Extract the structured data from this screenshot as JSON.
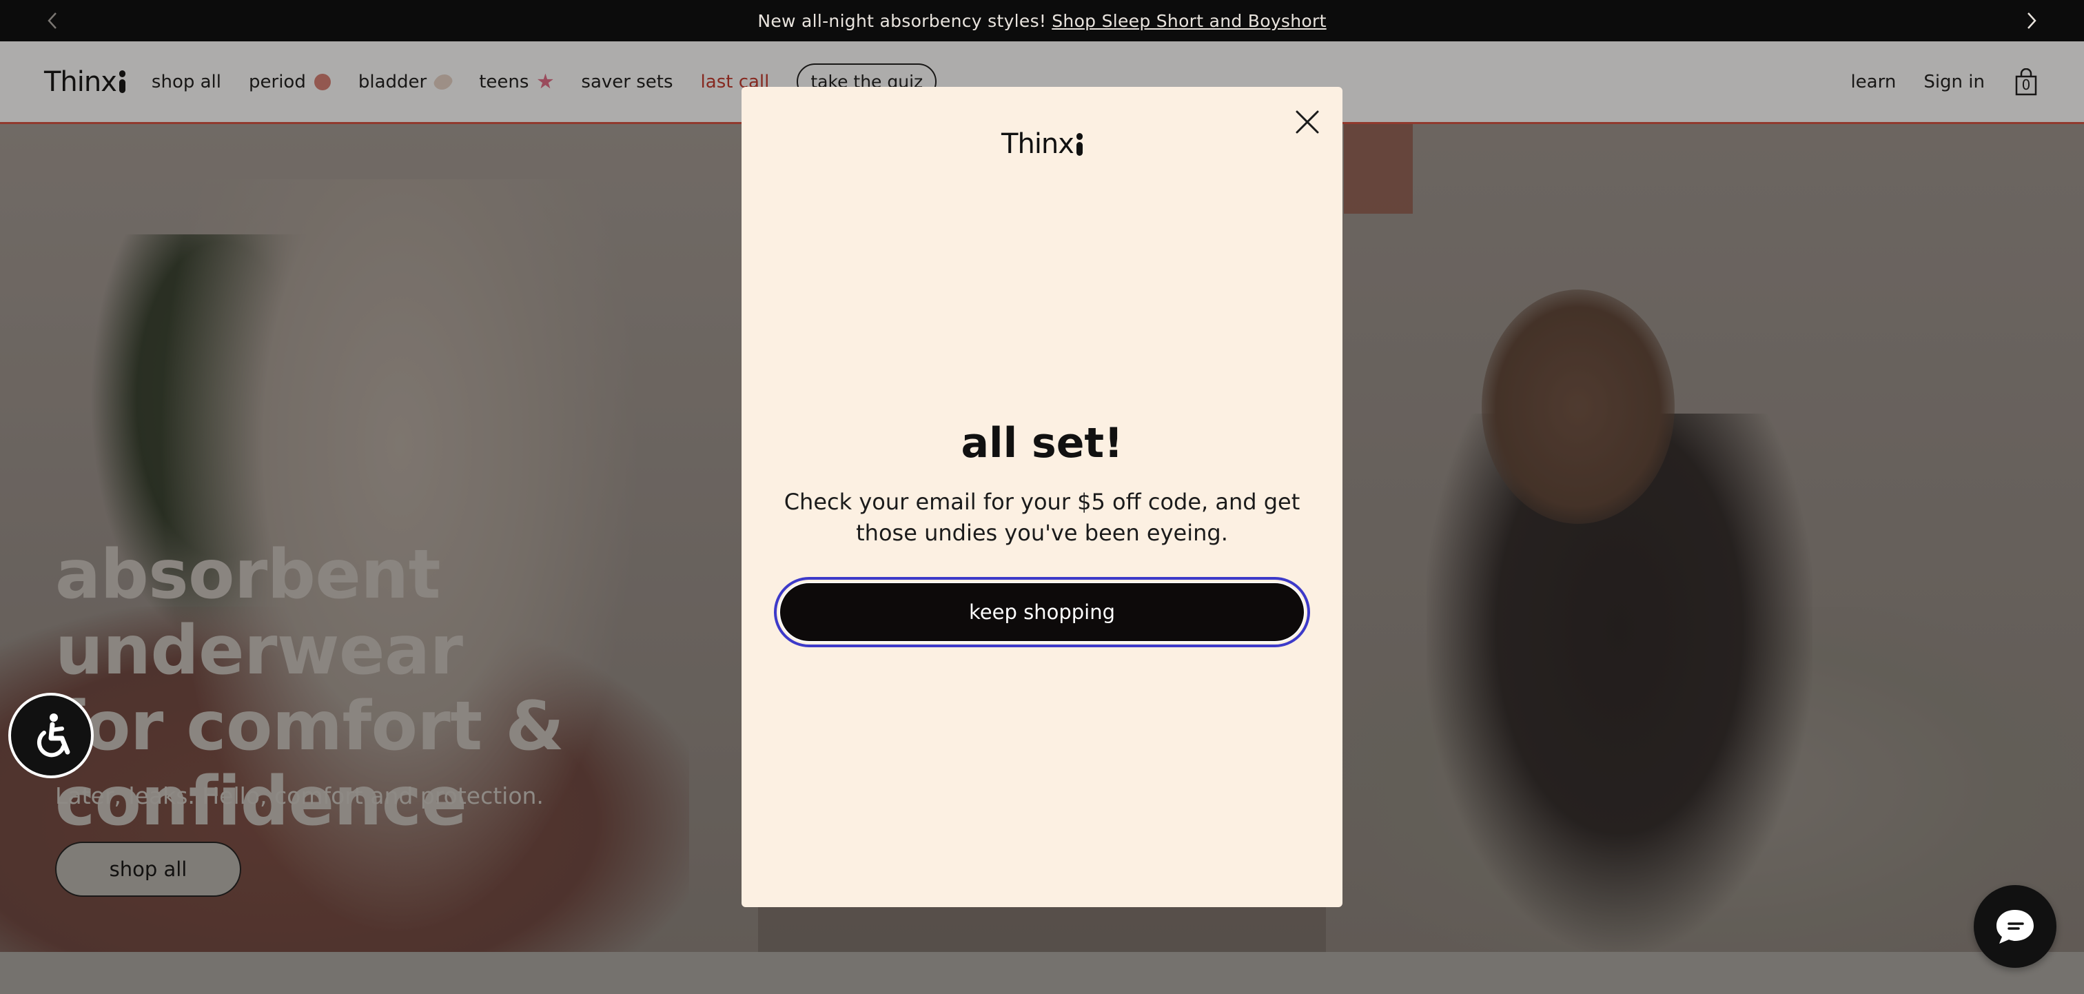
{
  "announcement": {
    "text": "New all-night absorbency styles!",
    "link": "Shop Sleep Short and Boyshort"
  },
  "brand": {
    "name": "Thinx"
  },
  "nav": {
    "items": [
      {
        "label": "shop all"
      },
      {
        "label": "period"
      },
      {
        "label": "bladder"
      },
      {
        "label": "teens"
      },
      {
        "label": "saver sets"
      },
      {
        "label": "last call"
      }
    ],
    "quiz": "take the quiz",
    "learn": "learn",
    "signin": "Sign in",
    "cart_count": "0"
  },
  "hero": {
    "title_line1": "absorbent underwear",
    "title_line2": "for comfort &",
    "title_line3": "confidence",
    "subtitle": "Later, leaks. Hello, comfort and protection.",
    "button": "shop all"
  },
  "modal": {
    "logo": "Thinx",
    "title": "all set!",
    "body": "Check your email for your $5 off code, and get those undies you've been eyeing.",
    "button": "keep shopping"
  },
  "colors": {
    "announce_bg": "#0c0c0c",
    "accent_red": "#c4362a",
    "modal_bg": "#fcf0e2",
    "focus_ring": "#3d3ac9"
  },
  "icons": {
    "announce_prev": "chevron-left-icon",
    "announce_next": "chevron-right-icon",
    "cart": "shopping-bag-icon",
    "close": "close-icon",
    "accessibility": "wheelchair-icon",
    "chat": "chat-bubble-icon"
  }
}
